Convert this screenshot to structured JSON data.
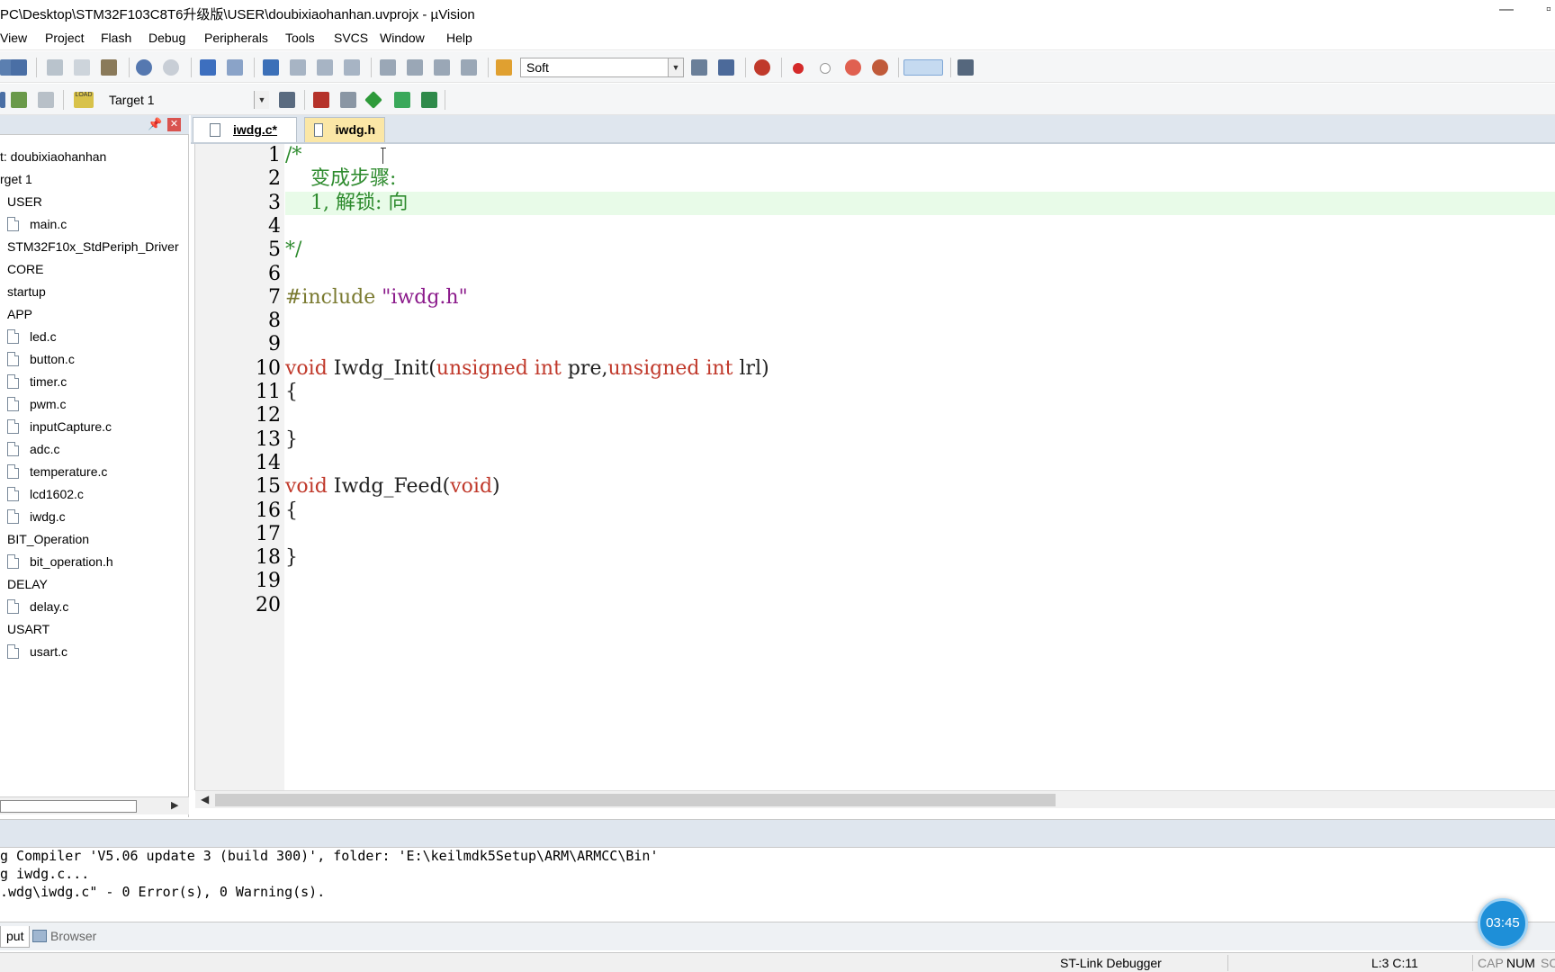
{
  "window": {
    "title": "PC\\Desktop\\STM32F103C8T6升级版\\USER\\doubixiaohanhan.uvprojx - µVision",
    "minimize": "—",
    "maximize": "▫"
  },
  "menu": [
    "View",
    "Project",
    "Flash",
    "Debug",
    "Peripherals",
    "Tools",
    "SVCS",
    "Window",
    "Help"
  ],
  "toolbar1": {
    "find_combo": "Soft",
    "icons": [
      "save-all-icon",
      "cut-icon",
      "copy-icon",
      "paste-icon",
      "undo-icon",
      "redo-icon",
      "nav-back-icon",
      "nav-forward-icon",
      "bookmark-set-icon",
      "bookmark-prev-icon",
      "bookmark-next-icon",
      "bookmark-clear-icon",
      "indent-icon",
      "unindent-icon",
      "comment-icon",
      "uncomment-icon",
      "find-in-files-icon",
      "find-combo",
      "incremental-find-icon",
      "search-replace-icon",
      "debug-start-icon",
      "breakpoint-insert-icon",
      "breakpoint-disable-icon",
      "breakpoint-kill-icon",
      "breakpoint-all-icon",
      "window-layout-icon",
      "configure-icon"
    ]
  },
  "toolbar2": {
    "load_label": "LOAD",
    "target_combo": "Target 1",
    "icons": [
      "translate-icon",
      "build-icon",
      "rebuild-icon",
      "download-icon",
      "target-options-icon",
      "manage-components-icon",
      "pack-installer-icon",
      "select-packs-icon",
      "gem-icon",
      "run-env-icon"
    ]
  },
  "project_panel": {
    "pin": "📌",
    "close": "✕",
    "items": [
      {
        "label": "t: doubixiaohanhan",
        "type": "project"
      },
      {
        "label": "rget 1",
        "type": "target"
      },
      {
        "label": "USER",
        "type": "group"
      },
      {
        "label": "main.c",
        "type": "file"
      },
      {
        "label": "STM32F10x_StdPeriph_Driver",
        "type": "group"
      },
      {
        "label": "CORE",
        "type": "group"
      },
      {
        "label": "startup",
        "type": "group"
      },
      {
        "label": "APP",
        "type": "group"
      },
      {
        "label": "led.c",
        "type": "file"
      },
      {
        "label": "button.c",
        "type": "file"
      },
      {
        "label": "timer.c",
        "type": "file"
      },
      {
        "label": "pwm.c",
        "type": "file"
      },
      {
        "label": "inputCapture.c",
        "type": "file"
      },
      {
        "label": "adc.c",
        "type": "file"
      },
      {
        "label": "temperature.c",
        "type": "file"
      },
      {
        "label": "lcd1602.c",
        "type": "file"
      },
      {
        "label": "iwdg.c",
        "type": "file"
      },
      {
        "label": "BIT_Operation",
        "type": "group"
      },
      {
        "label": "bit_operation.h",
        "type": "file"
      },
      {
        "label": "DELAY",
        "type": "group"
      },
      {
        "label": "delay.c",
        "type": "file"
      },
      {
        "label": "USART",
        "type": "group"
      },
      {
        "label": "usart.c",
        "type": "file"
      }
    ]
  },
  "editor_tabs": [
    {
      "label": "iwdg.c*",
      "active": true
    },
    {
      "label": "iwdg.h",
      "active": false
    }
  ],
  "editor": {
    "line_numbers": [
      "1",
      "2",
      "3",
      "4",
      "5",
      "6",
      "7",
      "8",
      "9",
      "10",
      "11",
      "12",
      "13",
      "14",
      "15",
      "16",
      "17",
      "18",
      "19",
      "20"
    ],
    "highlighted_line": 3,
    "lines": [
      {
        "n": 1,
        "segments": [
          {
            "t": "/*",
            "c": "cm"
          }
        ]
      },
      {
        "n": 2,
        "segments": [
          {
            "t": "    变成步骤:",
            "c": "cm"
          }
        ]
      },
      {
        "n": 3,
        "segments": [
          {
            "t": "    1, 解锁: 向",
            "c": "cm"
          }
        ]
      },
      {
        "n": 4,
        "segments": []
      },
      {
        "n": 5,
        "segments": [
          {
            "t": "*/",
            "c": "cm"
          }
        ]
      },
      {
        "n": 6,
        "segments": []
      },
      {
        "n": 7,
        "segments": [
          {
            "t": "#include ",
            "c": "pp"
          },
          {
            "t": "\"iwdg.h\"",
            "c": "st"
          }
        ]
      },
      {
        "n": 8,
        "segments": []
      },
      {
        "n": 9,
        "segments": []
      },
      {
        "n": 10,
        "segments": [
          {
            "t": "void",
            "c": "kw"
          },
          {
            "t": " Iwdg_Init(",
            "c": "id"
          },
          {
            "t": "unsigned int",
            "c": "kw"
          },
          {
            "t": " pre,",
            "c": "id"
          },
          {
            "t": "unsigned int",
            "c": "kw"
          },
          {
            "t": " lrl)",
            "c": "id"
          }
        ]
      },
      {
        "n": 11,
        "segments": [
          {
            "t": "{",
            "c": "id"
          }
        ]
      },
      {
        "n": 12,
        "segments": []
      },
      {
        "n": 13,
        "segments": [
          {
            "t": "}",
            "c": "id"
          }
        ]
      },
      {
        "n": 14,
        "segments": []
      },
      {
        "n": 15,
        "segments": [
          {
            "t": "void",
            "c": "kw"
          },
          {
            "t": " Iwdg_Feed(",
            "c": "id"
          },
          {
            "t": "void",
            "c": "kw"
          },
          {
            "t": ")",
            "c": "id"
          }
        ]
      },
      {
        "n": 16,
        "segments": [
          {
            "t": "{",
            "c": "id"
          }
        ]
      },
      {
        "n": 17,
        "segments": []
      },
      {
        "n": 18,
        "segments": [
          {
            "t": "}",
            "c": "id"
          }
        ]
      },
      {
        "n": 19,
        "segments": []
      },
      {
        "n": 20,
        "segments": []
      }
    ]
  },
  "build_output": {
    "lines": [
      "g Compiler 'V5.06 update 3 (build 300)', folder: 'E:\\keilmdk5Setup\\ARM\\ARMCC\\Bin'",
      "g iwdg.c...",
      ".wdg\\iwdg.c\" - 0 Error(s), 0 Warning(s)."
    ]
  },
  "bottom_tabs": [
    {
      "label": "put",
      "active": true
    },
    {
      "label": "Browser",
      "active": false
    }
  ],
  "status": {
    "debugger": "ST-Link Debugger",
    "position": "L:3 C:11",
    "cap": "CAP",
    "num": "NUM",
    "scrl": "SC"
  },
  "timer_badge": "03:45",
  "colors": {
    "comment": "#2e8b2e",
    "keyword": "#c0392b",
    "preprocessor": "#7a7a30",
    "string": "#8b1a8b",
    "highlight_line": "#e8fbe8",
    "badge": "#1e8fd8"
  }
}
